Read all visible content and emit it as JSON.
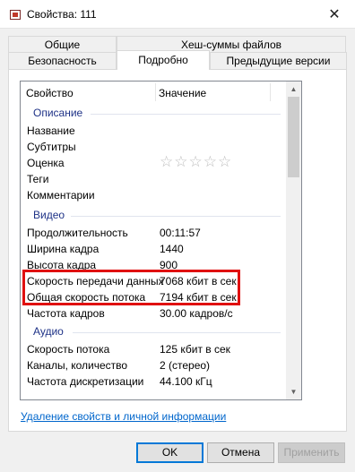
{
  "window": {
    "title": "Свойства: 111",
    "close_glyph": "✕"
  },
  "tabs": {
    "row1": [
      "Общие",
      "Хеш-суммы файлов"
    ],
    "row2": [
      "Безопасность",
      "Подробно",
      "Предыдущие версии"
    ],
    "active": "Подробно"
  },
  "list": {
    "header": {
      "property": "Свойство",
      "value": "Значение"
    },
    "groups": {
      "description": "Описание",
      "video": "Видео",
      "audio": "Аудио"
    },
    "description_rows": [
      {
        "key": "Название",
        "value": ""
      },
      {
        "key": "Субтитры",
        "value": ""
      },
      {
        "key": "Оценка",
        "value": "☆☆☆☆☆"
      },
      {
        "key": "Теги",
        "value": ""
      },
      {
        "key": "Комментарии",
        "value": ""
      }
    ],
    "video_rows": [
      {
        "key": "Продолжительность",
        "value": "00:11:57"
      },
      {
        "key": "Ширина кадра",
        "value": "1440"
      },
      {
        "key": "Высота кадра",
        "value": "900"
      },
      {
        "key": "Скорость передачи данных",
        "value": "7068 кбит в сек"
      },
      {
        "key": "Общая скорость потока",
        "value": "7194 кбит в сек"
      },
      {
        "key": "Частота кадров",
        "value": "30.00 кадров/с"
      }
    ],
    "audio_rows": [
      {
        "key": "Скорость потока",
        "value": "125 кбит в сек"
      },
      {
        "key": "Каналы, количество",
        "value": "2 (стерео)"
      },
      {
        "key": "Частота дискретизации",
        "value": "44.100 кГц"
      }
    ]
  },
  "link": "Удаление свойств и личной информации",
  "buttons": {
    "ok": "OK",
    "cancel": "Отмена",
    "apply": "Применить"
  },
  "colors": {
    "highlight": "#e01010",
    "group_label": "#1e3287",
    "link": "#0066cc",
    "ok_focus": "#0078d7"
  }
}
